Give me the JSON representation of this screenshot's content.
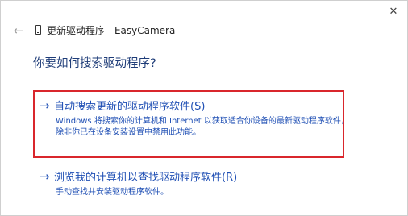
{
  "window": {
    "close_symbol": "✕",
    "title": "更新驱动程序 - EasyCamera"
  },
  "nav": {
    "back_symbol": "←",
    "device_icon": "device-icon"
  },
  "prompt": {
    "question": "你要如何搜索驱动程序?"
  },
  "options": [
    {
      "arrow": "→",
      "label": "自动搜索更新的驱动程序软件(S)",
      "description_lines": [
        "Windows 将搜索你的计算机和 Internet 以获取适合你设备的最新驱动程序软件，",
        "除非你已在设备安装设置中禁用此功能。"
      ],
      "highlighted": true,
      "highlight_color": "#d9262c"
    },
    {
      "arrow": "→",
      "label": "浏览我的计算机以查找驱动程序软件(R)",
      "description_lines": [
        "手动查找并安装驱动程序软件。"
      ]
    }
  ],
  "colors": {
    "link": "#1f4fb4",
    "heading": "#1e3c78"
  }
}
